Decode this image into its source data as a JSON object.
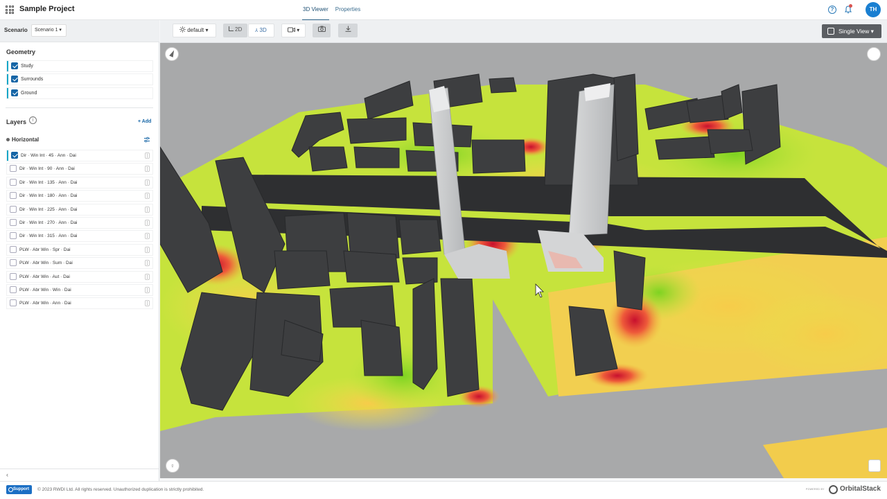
{
  "header": {
    "project_title": "Sample Project",
    "tabs": [
      {
        "label": "3D Viewer",
        "active": true
      },
      {
        "label": "Properties",
        "active": false
      }
    ],
    "user_initials": "TH"
  },
  "sidebar": {
    "scenario_label": "Scenario",
    "scenario_value": "Scenario 1",
    "geometry_title": "Geometry",
    "geometry_items": [
      {
        "label": "Study",
        "checked": true
      },
      {
        "label": "Surrounds",
        "checked": true
      },
      {
        "label": "Ground",
        "checked": true
      }
    ],
    "layers_title": "Layers",
    "add_label": "+ Add",
    "group_title": "Horizontal",
    "layers": [
      {
        "label": "Dir · Win Int · 45 · Ann · Dai",
        "checked": true
      },
      {
        "label": "Dir · Win Int · 90 · Ann · Dai",
        "checked": false
      },
      {
        "label": "Dir · Win Int · 135 · Ann · Dai",
        "checked": false
      },
      {
        "label": "Dir · Win Int · 180 · Ann · Dai",
        "checked": false
      },
      {
        "label": "Dir · Win Int · 225 · Ann · Dai",
        "checked": false
      },
      {
        "label": "Dir · Win Int · 270 · Ann · Dai",
        "checked": false
      },
      {
        "label": "Dir · Win Int · 315 · Ann · Dai",
        "checked": false
      },
      {
        "label": "PLW · Abr Win · Spr · Dai",
        "checked": false
      },
      {
        "label": "PLW · Abr Win · Sum · Dai",
        "checked": false
      },
      {
        "label": "PLW · Abr Win · Aut · Dai",
        "checked": false
      },
      {
        "label": "PLW · Abr Win · Win · Dai",
        "checked": false
      },
      {
        "label": "PLW · Abr Win · Ann · Dai",
        "checked": false
      }
    ]
  },
  "toolbar": {
    "lighting_label": "default",
    "mode_2d": "2D",
    "mode_3d": "3D",
    "view_mode_label": "Single View"
  },
  "footer": {
    "support_label": "Support",
    "copyright": "© 2023 RWDI Ltd. All rights reserved. Unauthorized duplication is strictly prohibited.",
    "powered_by": "POWERED BY",
    "brand": "OrbitalStack"
  }
}
